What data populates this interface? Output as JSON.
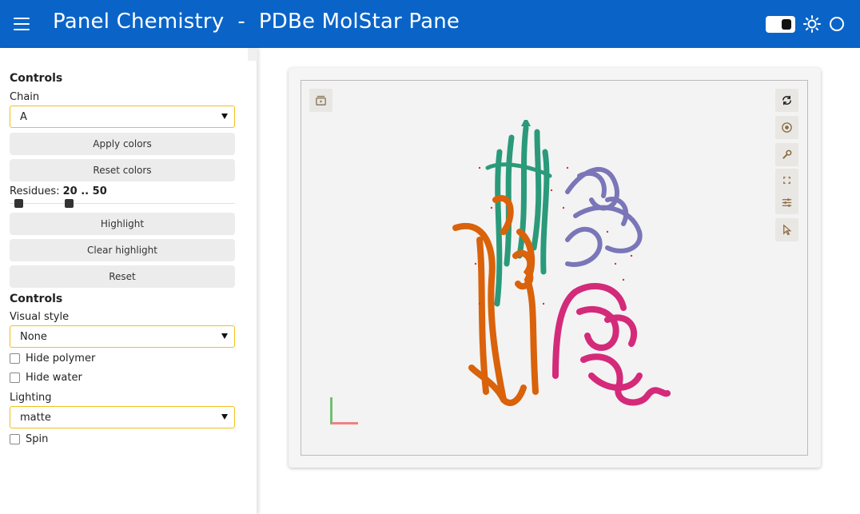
{
  "header": {
    "title": "Panel Chemistry  -  PDBe MolStar Pane",
    "theme_toggle": "dark-mode-toggle",
    "icons": [
      "menu-icon",
      "sun-icon",
      "circle-icon"
    ]
  },
  "sidebar": {
    "controls_title_1": "Controls",
    "chain_label": "Chain",
    "chain_value": "A",
    "apply_colors_label": "Apply colors",
    "reset_colors_label": "Reset colors",
    "residues_label": "Residues:",
    "residues_value": "20 .. 50",
    "highlight_label": "Highlight",
    "clear_highlight_label": "Clear highlight",
    "reset_label": "Reset",
    "controls_title_2": "Controls",
    "visual_style_label": "Visual style",
    "visual_style_value": "None",
    "hide_polymer_label": "Hide polymer",
    "hide_water_label": "Hide water",
    "lighting_label": "Lighting",
    "lighting_value": "matte",
    "spin_label": "Spin"
  },
  "viewer": {
    "toolbar_left": [
      "animation-icon"
    ],
    "toolbar_right": [
      "reset-camera-icon",
      "screenshot-icon",
      "settings-icon",
      "expand-icon",
      "controls-icon",
      "selection-mode-icon"
    ],
    "colors": {
      "chain_green": "#2a9a7a",
      "chain_orange": "#d9620a",
      "chain_purple": "#7a76b8",
      "chain_pink": "#d42a7a"
    }
  }
}
